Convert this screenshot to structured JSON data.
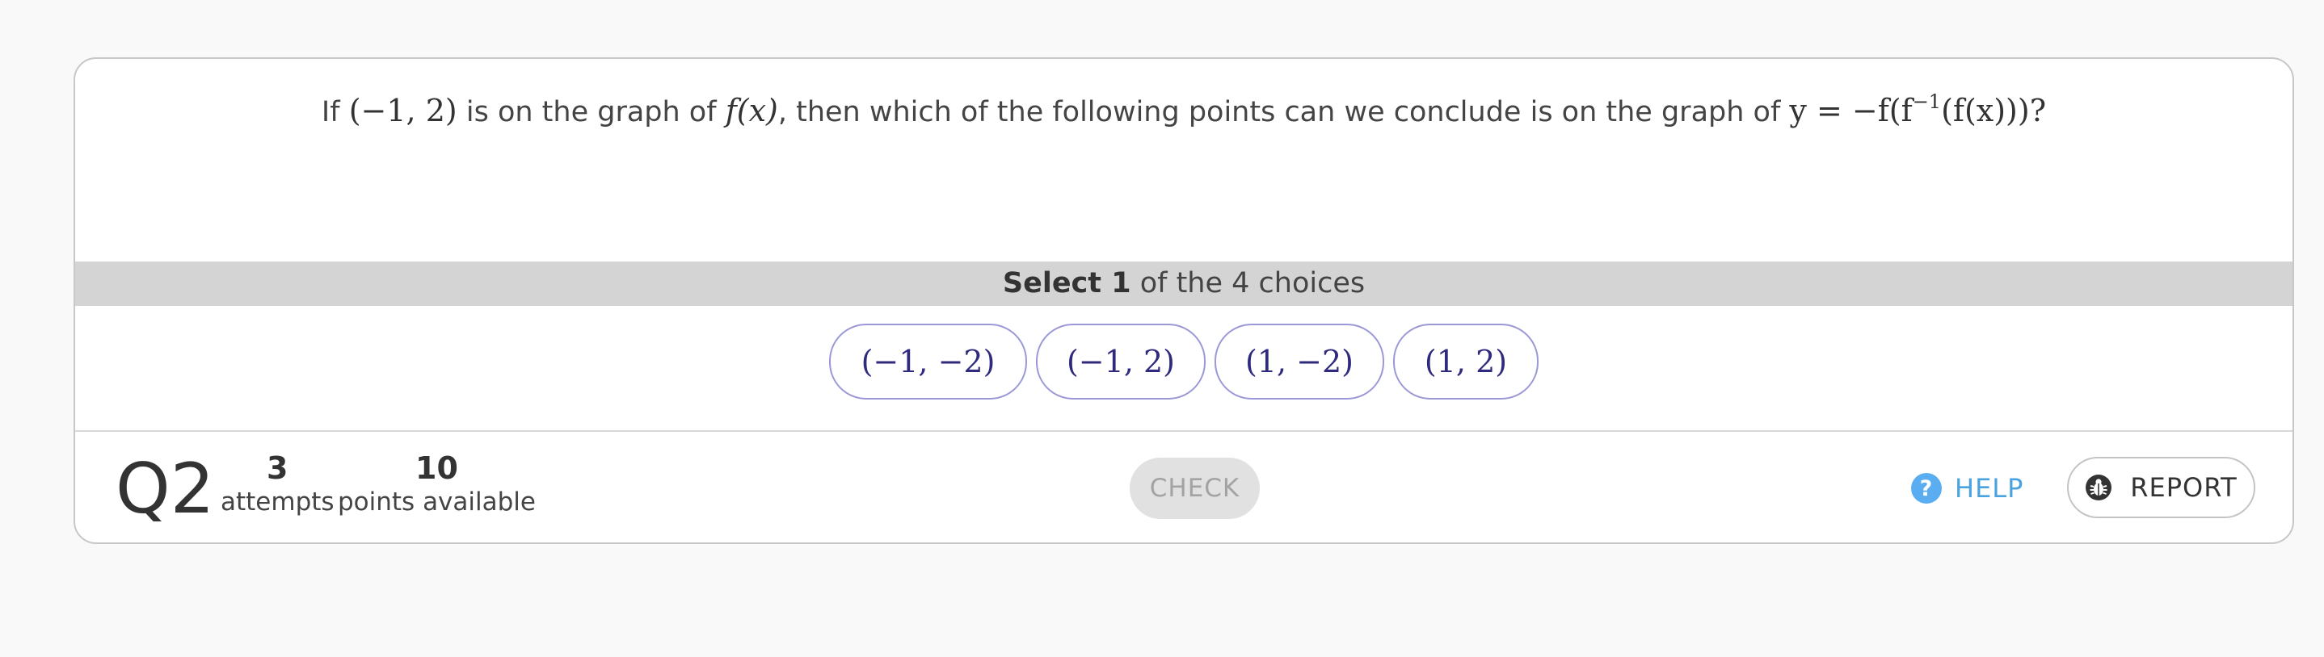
{
  "question": {
    "prefix": "If",
    "point": "(−1, 2)",
    "mid1": "is on the graph of",
    "fx": "f(x)",
    "mid2": ", then which of the following points can we conclude is on the graph of",
    "expr_main": "y = −f(f",
    "expr_sup": "−1",
    "expr_tail": "(f(x)))",
    "suffix": "?"
  },
  "select_bar": {
    "bold": "Select 1",
    "rest": "of the 4 choices"
  },
  "choices": [
    {
      "label": "(−1, −2)"
    },
    {
      "label": "(−1, 2)"
    },
    {
      "label": "(1, −2)"
    },
    {
      "label": "(1, 2)"
    }
  ],
  "footer": {
    "question_number": "Q2",
    "attempts_value": "3",
    "attempts_label": "attempts",
    "points_value": "10",
    "points_label": "points available",
    "check_label": "CHECK",
    "help_icon_glyph": "?",
    "help_label": "HELP",
    "report_label": "REPORT"
  },
  "colors": {
    "choice_border": "#9a98d6",
    "choice_text": "#2f2a7e",
    "help_blue": "#4aa3df",
    "select_bar_bg": "#d4d4d4",
    "check_disabled_bg": "#e1e1e1"
  },
  "icons": {
    "help": "question-circle-icon",
    "report": "bug-icon"
  }
}
